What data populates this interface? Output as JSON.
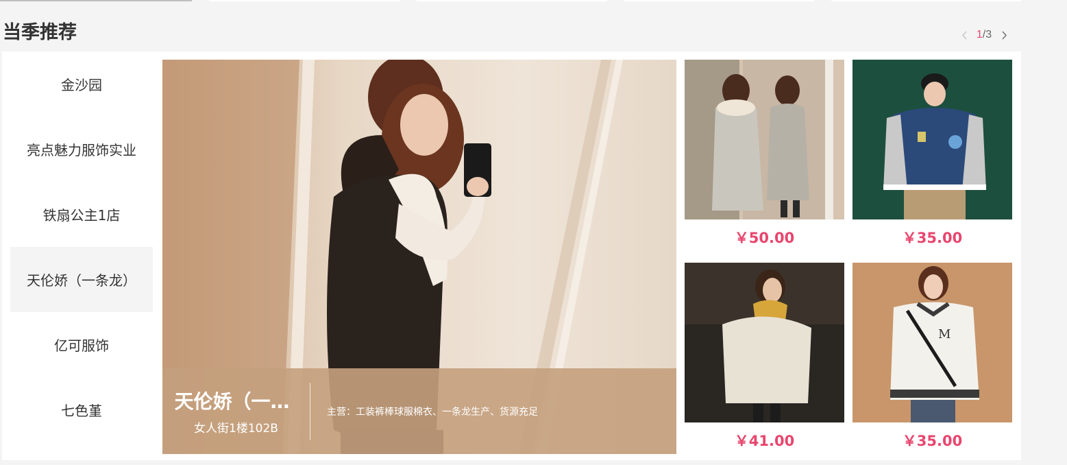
{
  "section": {
    "title": "当季推荐",
    "pager": {
      "current": "1",
      "total": "/3"
    }
  },
  "stores": [
    {
      "name": "金沙园"
    },
    {
      "name": "亮点魅力服饰实业"
    },
    {
      "name": "铁扇公主1店"
    },
    {
      "name": "天伦娇（一条龙）"
    },
    {
      "name": "亿可服饰"
    },
    {
      "name": "七色堇"
    }
  ],
  "active_store_index": 3,
  "featured": {
    "name": "天伦娇（一条龙）",
    "location": "女人街1楼102B",
    "main_business": "主营：工装裤棒球服棉衣、一条龙生产、货源充足"
  },
  "products": [
    {
      "price": "￥50.00"
    },
    {
      "price": "￥35.00"
    },
    {
      "price": "￥41.00"
    },
    {
      "price": "￥35.00"
    }
  ],
  "colors": {
    "accent": "#e8466e",
    "caption_bg": "#c4a07d",
    "active_bg": "#f4f4f4"
  }
}
